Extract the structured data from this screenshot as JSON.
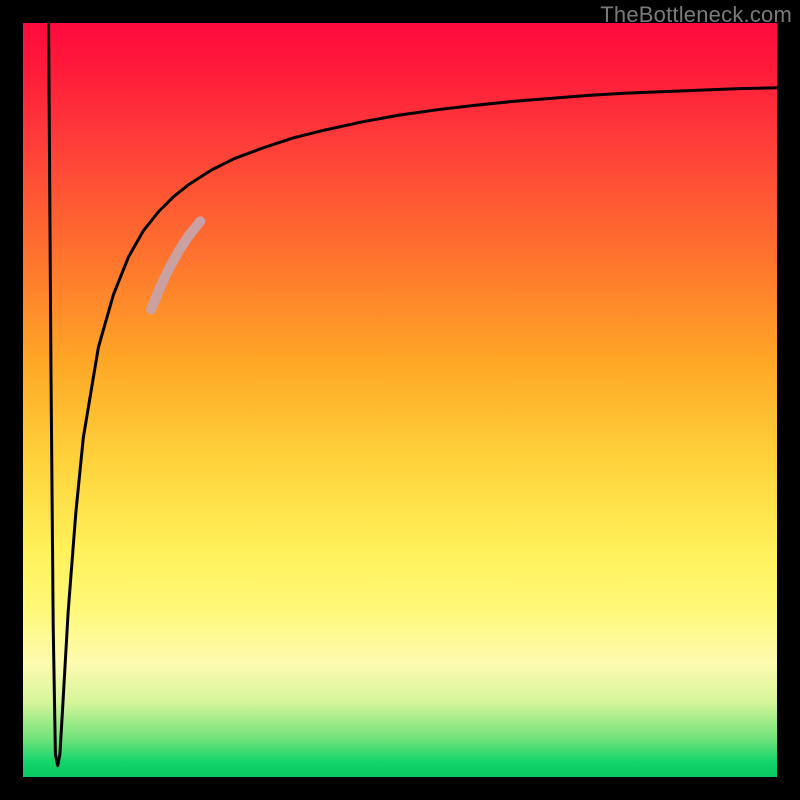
{
  "watermark": "TheBottleneck.com",
  "chart_data": {
    "type": "line",
    "title": "",
    "xlabel": "",
    "ylabel": "",
    "xlim": [
      0,
      100
    ],
    "ylim": [
      0,
      100
    ],
    "grid": false,
    "legend": false,
    "annotations": [],
    "series": [
      {
        "name": "curve",
        "color": "#000000",
        "x": [
          3.4,
          3.7,
          4.0,
          4.3,
          4.6,
          4.9,
          5.3,
          6.0,
          7.0,
          8.0,
          10.0,
          12.0,
          14.0,
          16.0,
          18.0,
          20.0,
          22.0,
          25.0,
          28.0,
          32.0,
          36.0,
          40.0,
          45.0,
          50.0,
          55.0,
          60.0,
          65.0,
          70.0,
          75.0,
          80.0,
          85.0,
          90.0,
          95.0,
          100.0
        ],
        "y": [
          100.0,
          55.0,
          20.0,
          3.0,
          1.5,
          3.0,
          10.0,
          22.0,
          35.0,
          45.0,
          57.0,
          64.0,
          69.0,
          72.5,
          75.0,
          77.0,
          78.6,
          80.5,
          82.0,
          83.5,
          84.8,
          85.8,
          86.9,
          87.8,
          88.5,
          89.1,
          89.6,
          90.0,
          90.4,
          90.7,
          90.9,
          91.1,
          91.3,
          91.4
        ]
      },
      {
        "name": "highlight-segment",
        "color": "#caa0a0",
        "x": [
          17.0,
          18.0,
          19.0,
          20.0,
          21.0,
          22.0,
          23.5
        ],
        "y": [
          62.0,
          64.5,
          66.7,
          68.6,
          70.3,
          71.8,
          73.7
        ]
      }
    ]
  },
  "colors": {
    "curve": "#000000",
    "highlight": "#caa0a0",
    "frame": "#000000",
    "watermark": "#7a7a7a"
  }
}
